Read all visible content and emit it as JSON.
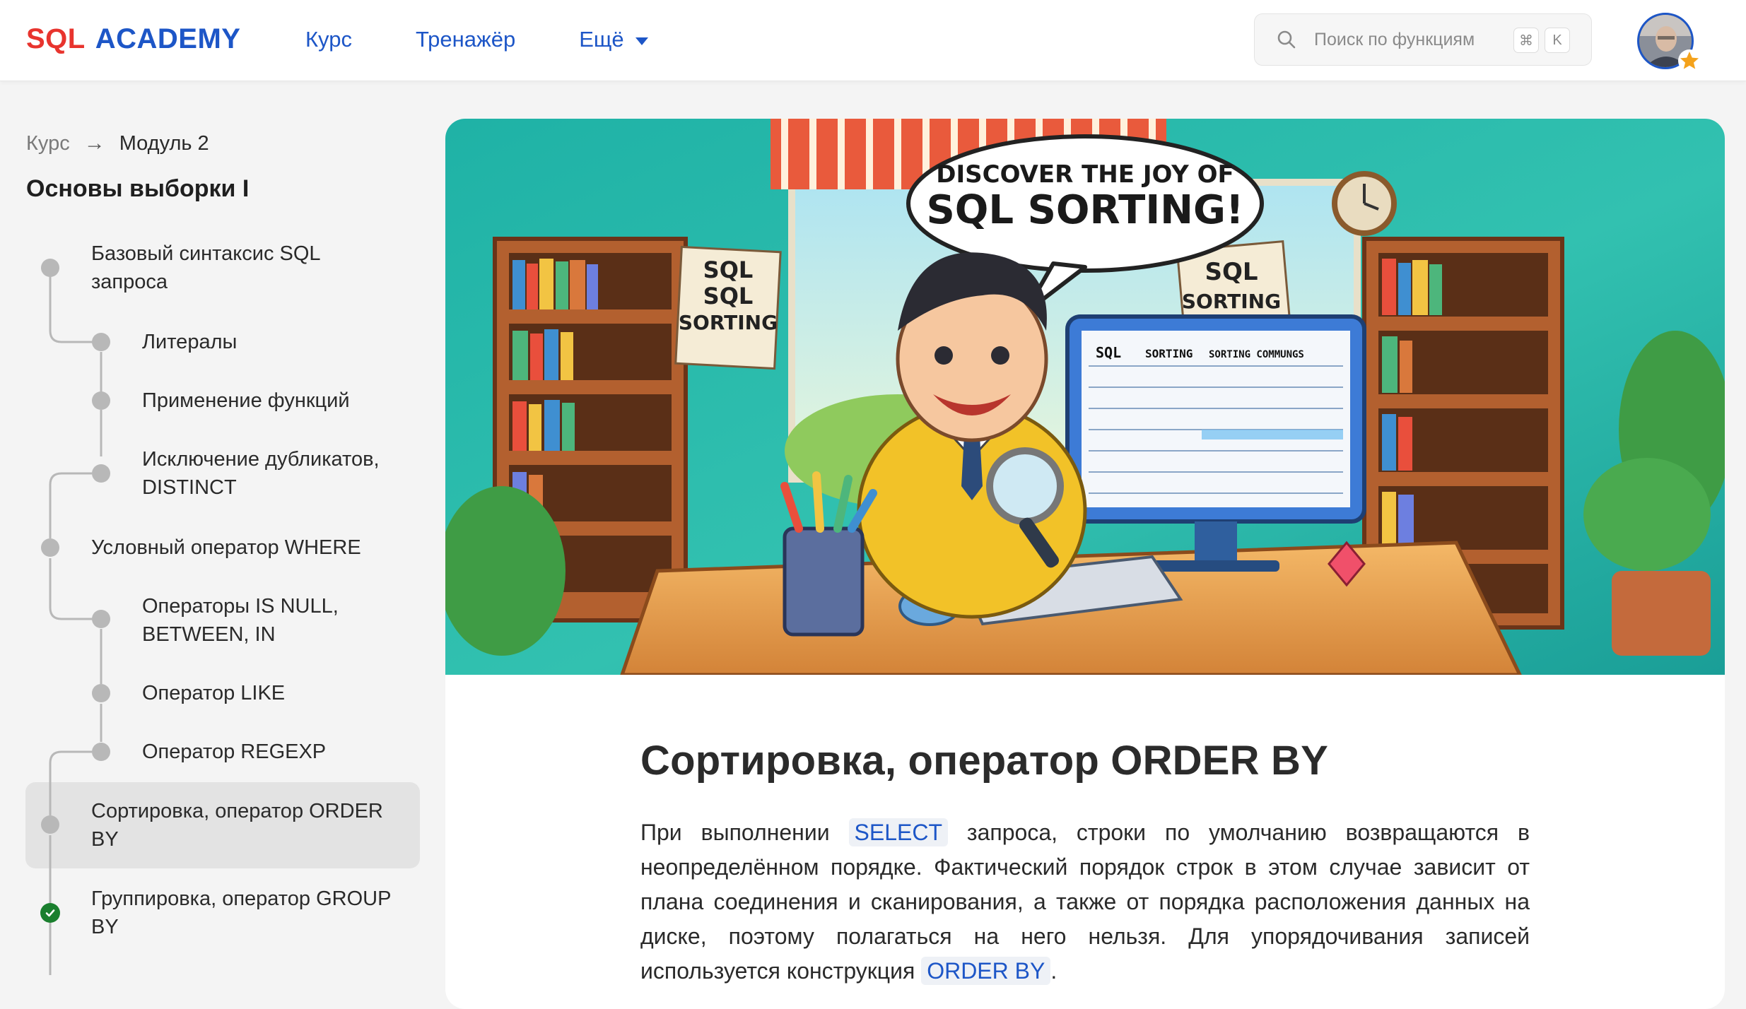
{
  "header": {
    "logo": {
      "part1": "SQL",
      "part2": "ACADEMY"
    },
    "nav": [
      {
        "label": "Курс"
      },
      {
        "label": "Тренажёр"
      },
      {
        "label": "Ещё"
      }
    ],
    "search": {
      "placeholder": "Поиск по функциям",
      "shortcut_mod": "⌘",
      "shortcut_key": "K"
    },
    "avatar": {
      "badge": "star-badge"
    }
  },
  "breadcrumb": {
    "root": "Курс",
    "current": "Модуль 2"
  },
  "sidebar": {
    "section_title": "Основы выборки I",
    "items": [
      {
        "label_line1": "Базовый синтаксис SQL",
        "label_line2": "запроса",
        "level": 0
      },
      {
        "label_line1": "Литералы",
        "level": 1
      },
      {
        "label_line1": "Применение функций",
        "level": 1
      },
      {
        "label_line1": "Исключение дубликатов,",
        "label_line2": "DISTINCT",
        "level": 1
      },
      {
        "label_line1": "Условный оператор WHERE",
        "level": 0
      },
      {
        "label_line1": "Операторы IS NULL,",
        "label_line2": "BETWEEN, IN",
        "level": 1
      },
      {
        "label_line1": "Оператор LIKE",
        "level": 1
      },
      {
        "label_line1": "Оператор REGEXP",
        "level": 1
      },
      {
        "label_line1": "Сортировка, оператор ORDER",
        "label_line2": "BY",
        "level": 0,
        "active": true
      },
      {
        "label_line1": "Группировка, оператор GROUP",
        "label_line2": "BY",
        "level": 0,
        "completed": true
      }
    ]
  },
  "hero": {
    "speech_line1": "DISCOVER THE JOY OF",
    "speech_line2": "SQL SORTING!",
    "poster_left": [
      "SQL",
      "SQL",
      "SORTING"
    ],
    "poster_right": [
      "SQL",
      "SORTING"
    ],
    "screen_header": [
      "SQL",
      "SORTING",
      "SORTING COMMUNGS"
    ]
  },
  "article": {
    "title": "Сортировка, оператор ORDER BY",
    "p_part1": "При выполнении ",
    "code1": "SELECT",
    "p_part2": " запроса, строки по умолчанию возвращаются в неопределённом порядке. Фактический порядок строк в этом случае зависит от плана соединения и сканирования, а также от порядка расположения данных на диске, поэтому полагаться на него нельзя. Для упорядочивания записей используется конструкция ",
    "code2": "ORDER BY",
    "p_part3": "."
  },
  "colors": {
    "brand_red": "#e8342e",
    "brand_blue": "#1d56c7",
    "done_green": "#1a7f2e"
  }
}
